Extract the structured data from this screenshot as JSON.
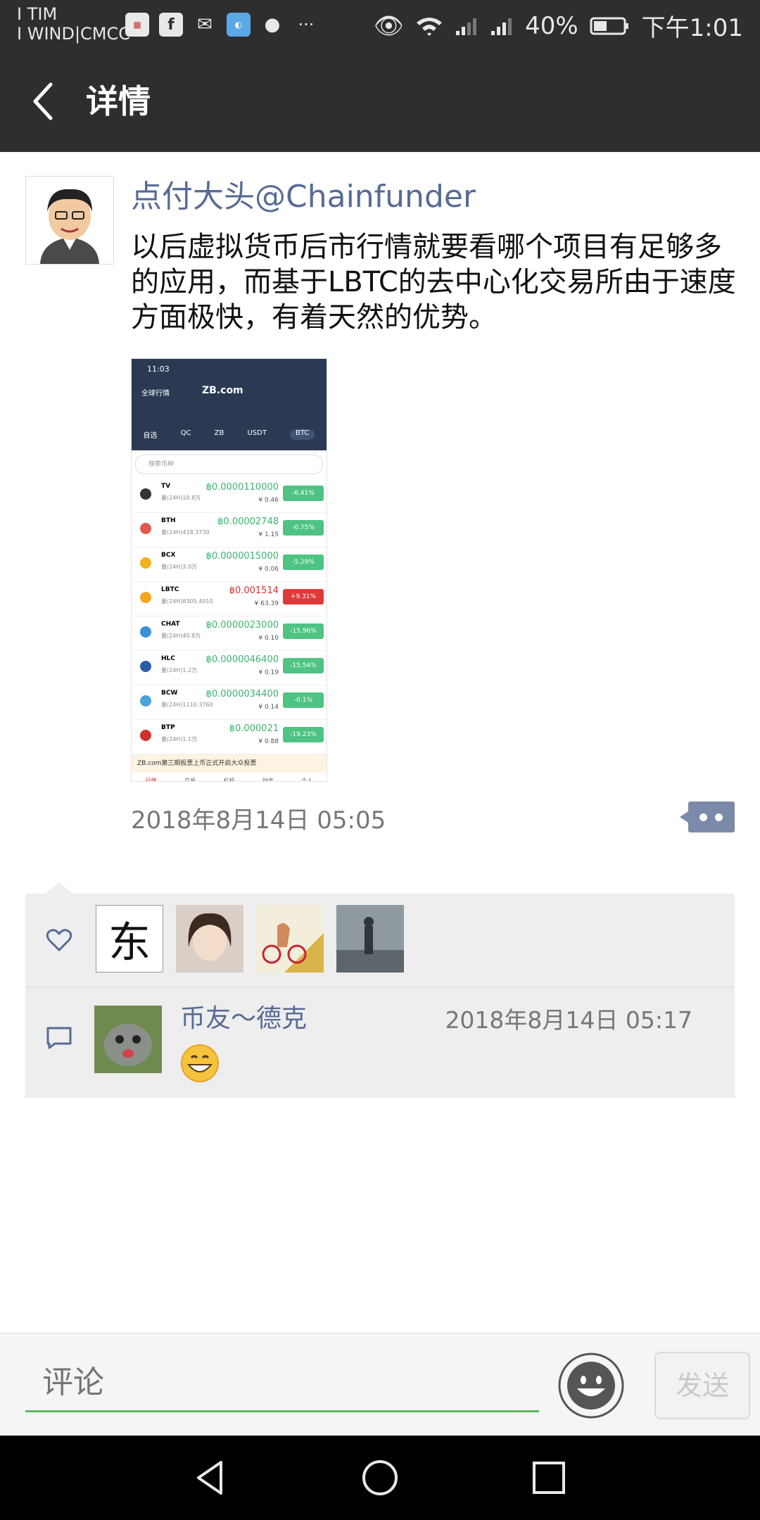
{
  "status_bar": {
    "carrier_line1": "I TIM",
    "carrier_line2": "I WIND|CMCC",
    "battery": "40%",
    "time": "下午1:01"
  },
  "header": {
    "title": "详情"
  },
  "post": {
    "author": "点付大头@Chainfunder",
    "text": "以后虚拟货币后市行情就要看哪个项目有足够多的应用，而基于LBTC的去中心化交易所由于速度方面极快，有着天然的优势。",
    "timestamp": "2018年8月14日 05:05"
  },
  "embedded_screenshot": {
    "time": "11:03",
    "header_left": "全球行情",
    "logo": "ZB.com",
    "tabs": [
      "自选",
      "QC",
      "ZB",
      "USDT",
      "BTC"
    ],
    "search_placeholder": "搜索币种",
    "coins": [
      {
        "name": "TV",
        "volume": "量(24H)10.8万",
        "price": "฿0.0000110000",
        "cny": "¥ 0.46",
        "change": "-6.41%",
        "up": false,
        "color": "#333333"
      },
      {
        "name": "BTH",
        "volume": "量(24H)418.3730",
        "price": "฿0.00002748",
        "cny": "¥ 1.15",
        "change": "-0.75%",
        "up": false,
        "color": "#e05a4f"
      },
      {
        "name": "BCX",
        "volume": "量(24H)3.0万",
        "price": "฿0.0000015000",
        "cny": "¥ 0.06",
        "change": "-5.29%",
        "up": false,
        "color": "#f2b01e"
      },
      {
        "name": "LBTC",
        "volume": "量(24H)8305.4010",
        "price": "฿0.001514",
        "cny": "¥ 63.39",
        "change": "+9.31%",
        "up": true,
        "color": "#f2a71e"
      },
      {
        "name": "CHAT",
        "volume": "量(24H)40.8万",
        "price": "฿0.0000023000",
        "cny": "¥ 0.10",
        "change": "-15.96%",
        "up": false,
        "color": "#3d8fd8"
      },
      {
        "name": "HLC",
        "volume": "量(24H)1.2万",
        "price": "฿0.0000046400",
        "cny": "¥ 0.19",
        "change": "-15.54%",
        "up": false,
        "color": "#2b5aa8"
      },
      {
        "name": "BCW",
        "volume": "量(24H)1110.3760",
        "price": "฿0.0000034400",
        "cny": "¥ 0.14",
        "change": "-0.1%",
        "up": false,
        "color": "#4aa3d8"
      },
      {
        "name": "BTP",
        "volume": "量(24H)1.1万",
        "price": "฿0.000021",
        "cny": "¥ 0.88",
        "change": "-19.23%",
        "up": false,
        "color": "#d0312d"
      }
    ],
    "notice": "ZB.com第三期投票上币正式开启大众投票",
    "bottom_nav": [
      "行情",
      "交易",
      "杠杆",
      "财务",
      "个人"
    ]
  },
  "likes": {
    "first_liker_char": "东"
  },
  "comment": {
    "author": "币友～德克",
    "time": "2018年8月14日 05:17"
  },
  "input": {
    "placeholder": "评论",
    "send_label": "发送"
  },
  "colors": {
    "link": "#576b95",
    "topbar": "#2e2e2e",
    "accent_green": "#5cb85c"
  }
}
